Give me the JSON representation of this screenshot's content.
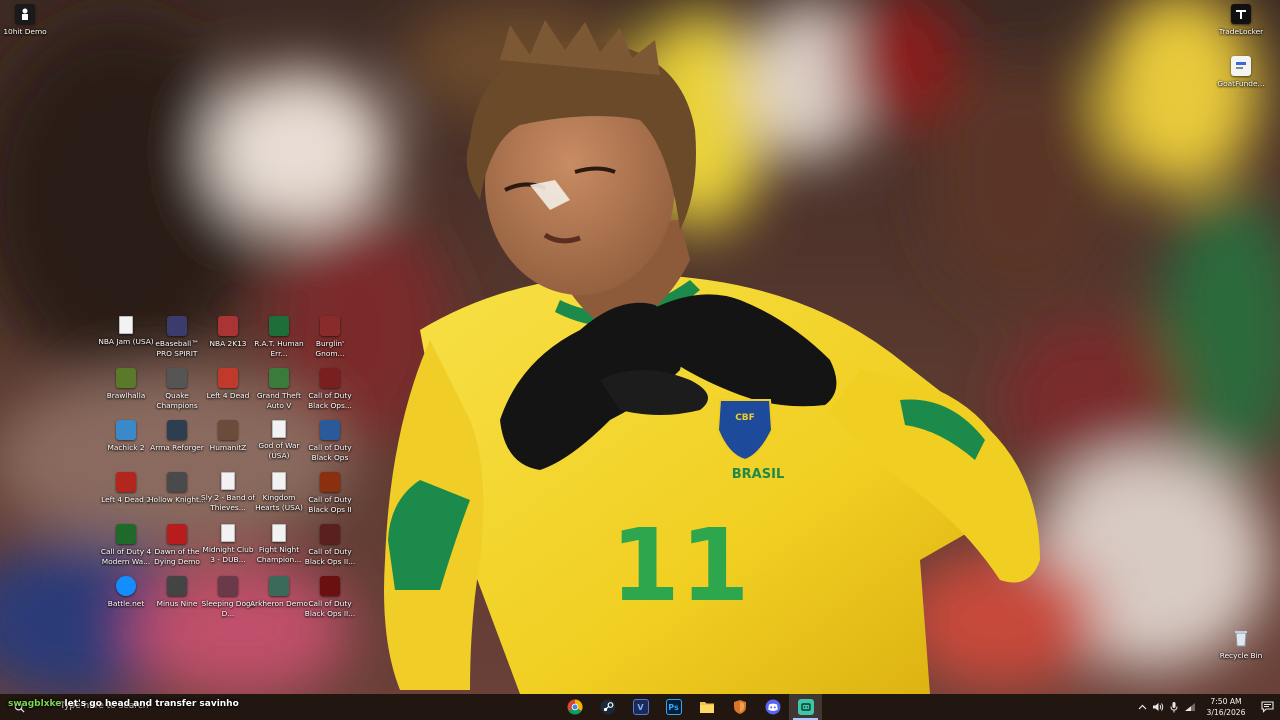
{
  "desktop": {
    "corner_icons": [
      {
        "label": "10hit Demo",
        "icon": "game-icon"
      },
      {
        "label": "TradeLocker",
        "icon": "tradelocker-icon"
      },
      {
        "label": "GoatFunde...",
        "icon": "shortcut-icon"
      },
      {
        "label": "Recycle Bin",
        "icon": "recycle-bin-icon"
      }
    ],
    "grid_icons": [
      {
        "label": "NBA Jam (USA)",
        "icon": "document-icon"
      },
      {
        "label": "eBaseball™ PRO SPIRIT",
        "icon": "game-icon"
      },
      {
        "label": "NBA 2K13",
        "icon": "game-icon"
      },
      {
        "label": "R.A.T. Human Err...",
        "icon": "game-icon"
      },
      {
        "label": "Burglin' Gnom...",
        "icon": "game-icon"
      },
      {
        "label": "Brawlhalla",
        "icon": "game-icon"
      },
      {
        "label": "Quake Champions",
        "icon": "game-icon"
      },
      {
        "label": "Left 4 Dead",
        "icon": "game-icon"
      },
      {
        "label": "Grand Theft Auto V",
        "icon": "game-icon"
      },
      {
        "label": "Call of Duty Black Ops...",
        "icon": "game-icon"
      },
      {
        "label": "Machick 2",
        "icon": "game-icon"
      },
      {
        "label": "Arma Reforger",
        "icon": "game-icon"
      },
      {
        "label": "HumanitZ",
        "icon": "game-icon"
      },
      {
        "label": "God of War (USA)",
        "icon": "document-icon"
      },
      {
        "label": "Call of Duty Black Ops",
        "icon": "game-icon"
      },
      {
        "label": "Left 4 Dead 2",
        "icon": "game-icon"
      },
      {
        "label": "Hollow Knight...",
        "icon": "game-icon"
      },
      {
        "label": "Sly 2 - Band of Thieves...",
        "icon": "document-icon"
      },
      {
        "label": "Kingdom Hearts (USA)",
        "icon": "document-icon"
      },
      {
        "label": "Call of Duty Black Ops II",
        "icon": "game-icon"
      },
      {
        "label": "Call of Duty 4 Modern Wa...",
        "icon": "game-icon"
      },
      {
        "label": "Dawn of the Dying Demo",
        "icon": "game-icon"
      },
      {
        "label": "Midnight Club 3 - DUB...",
        "icon": "document-icon"
      },
      {
        "label": "Fight Night Champion...",
        "icon": "document-icon"
      },
      {
        "label": "Call of Duty Black Ops II...",
        "icon": "game-icon"
      },
      {
        "label": "Battle.net",
        "icon": "battlenet-icon"
      },
      {
        "label": "Minus Nine",
        "icon": "game-icon"
      },
      {
        "label": "Sleeping Dogs D...",
        "icon": "game-icon"
      },
      {
        "label": "Arkheron Demo",
        "icon": "game-icon"
      },
      {
        "label": "Call of Duty Black Ops II...",
        "icon": "game-icon"
      }
    ]
  },
  "taskbar": {
    "search_placeholder": "Type here to search",
    "overlay_user": "swagblxke",
    "overlay_text": "let's go head and transfer savinho",
    "apps": [
      {
        "name": "Google Chrome",
        "icon": "chrome-icon"
      },
      {
        "name": "Steam",
        "icon": "steam-icon"
      },
      {
        "name": "V",
        "icon": "v-app-icon"
      },
      {
        "name": "Ps",
        "icon": "photoshop-icon"
      },
      {
        "name": "File Explorer",
        "icon": "folder-icon"
      },
      {
        "name": "App",
        "icon": "shield-app-icon"
      },
      {
        "name": "Discord",
        "icon": "discord-icon"
      },
      {
        "name": "Active App",
        "icon": "active-app-icon"
      }
    ],
    "clock_time": "7:50 AM",
    "clock_date": "3/16/2026",
    "tray_icons": [
      "chevron-up-icon",
      "volume-icon",
      "microphone-icon",
      "network-icon"
    ]
  },
  "wallpaper": {
    "jersey_number": "11",
    "crest_text": "CBF",
    "country_text": "BRASIL"
  },
  "colors": {
    "jersey_yellow": "#f3d32b",
    "jersey_green": "#1c8a4a",
    "taskbar_bg": "#201410",
    "overlay_user": "#79d851"
  }
}
